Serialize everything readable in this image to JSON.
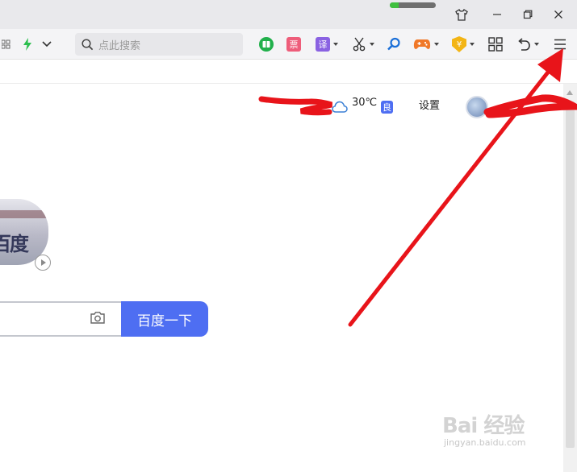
{
  "window": {
    "progress": 0.2,
    "controls": {
      "skin": "shirt-icon",
      "minimize": "minimize-icon",
      "restore": "restore-icon",
      "close": "close-icon"
    }
  },
  "toolbar": {
    "search_placeholder": "点此搜索",
    "items": [
      "grid-apps-icon",
      "lightning-icon",
      "chevron-down-icon",
      "book-icon",
      "news-icon",
      "translate-icon",
      "scissors-icon",
      "search-zoom-icon",
      "game-icon",
      "coin-shield-icon",
      "apps-grid-icon",
      "undo-icon",
      "menu-icon"
    ],
    "news_label": "票",
    "translate_label": "译",
    "coin_label": "¥"
  },
  "header": {
    "temperature": "30℃",
    "air_quality": "良",
    "settings": "设置"
  },
  "search": {
    "button_label": "百度一下"
  },
  "watermark": {
    "main": "Bai 经验",
    "sub": "jingyan.baidu.com"
  },
  "colors": {
    "brand_blue": "#4e6ef2",
    "annotation_red": "#e8141a"
  }
}
